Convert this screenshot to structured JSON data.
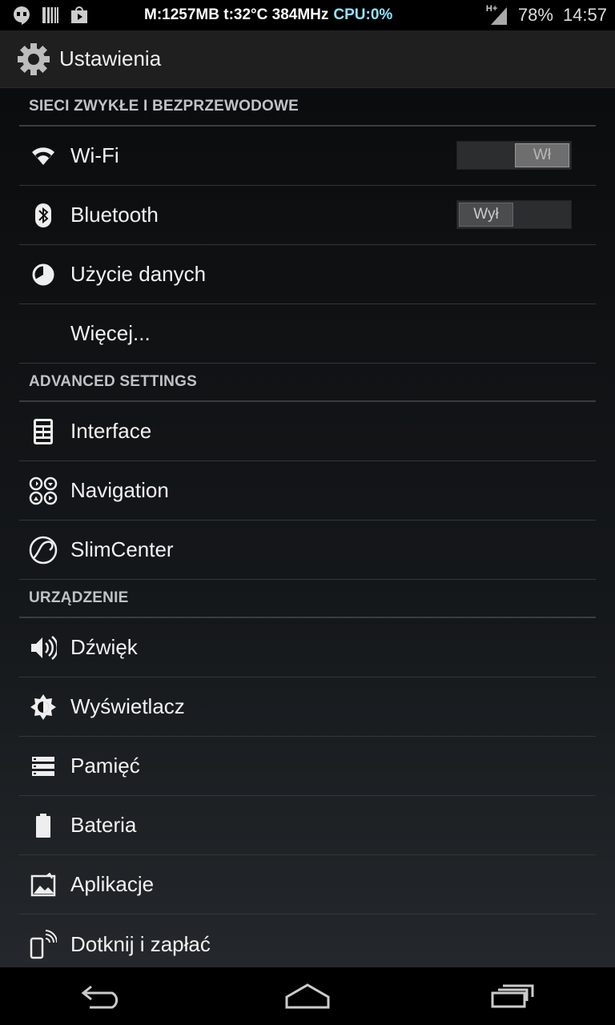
{
  "status_bar": {
    "left_icons": [
      "hangouts-icon",
      "barcode-icon",
      "play-store-icon"
    ],
    "mem": "M:1257MB",
    "temp": "t:32°C",
    "freq": "384MHz",
    "cpu": "CPU:0%",
    "network": "H+",
    "battery": "78%",
    "time": "14:57"
  },
  "action_bar": {
    "title": "Ustawienia",
    "icon": "settings-gear-icon"
  },
  "sections": [
    {
      "header": "SIECI ZWYKŁE I BEZPRZEWODOWE",
      "items": [
        {
          "label": "Wi-Fi",
          "icon": "wifi-icon",
          "toggle": "Wł"
        },
        {
          "label": "Bluetooth",
          "icon": "bluetooth-icon",
          "toggle": "Wył"
        },
        {
          "label": "Użycie danych",
          "icon": "data-usage-icon"
        },
        {
          "label": "Więcej..."
        }
      ]
    },
    {
      "header": "ADVANCED SETTINGS",
      "items": [
        {
          "label": "Interface",
          "icon": "interface-icon"
        },
        {
          "label": "Navigation",
          "icon": "navigation-icon"
        },
        {
          "label": "SlimCenter",
          "icon": "slimcenter-icon"
        }
      ]
    },
    {
      "header": "URZĄDZENIE",
      "items": [
        {
          "label": "Dźwięk",
          "icon": "sound-icon"
        },
        {
          "label": "Wyświetlacz",
          "icon": "display-icon"
        },
        {
          "label": "Pamięć",
          "icon": "storage-icon"
        },
        {
          "label": "Bateria",
          "icon": "battery-icon"
        },
        {
          "label": "Aplikacje",
          "icon": "apps-icon"
        },
        {
          "label": "Dotknij i zapłać",
          "icon": "tap-pay-icon"
        }
      ]
    }
  ],
  "nav_bar": [
    "back-icon",
    "home-icon",
    "recents-icon"
  ],
  "colors": {
    "background_top": "#0b0c0d",
    "background_bottom": "#24282c",
    "divider": "#3a3d40",
    "section_text": "#bfc3c6",
    "cpu_text": "#8fe3ff"
  }
}
